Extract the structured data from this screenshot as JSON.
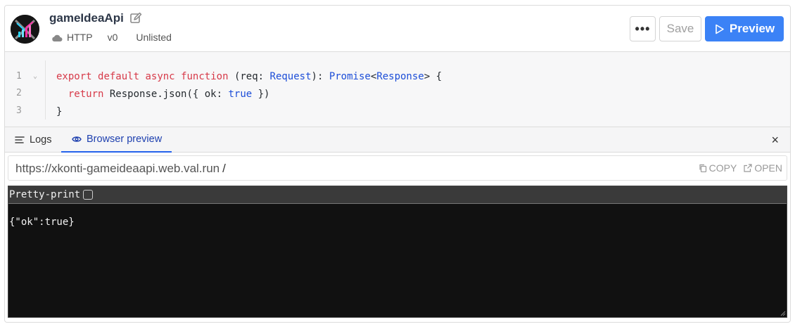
{
  "app": {
    "name": "gameIdeaApi",
    "meta": {
      "type": "HTTP",
      "version": "v0",
      "visibility": "Unlisted"
    }
  },
  "toolbar": {
    "more_label": "•••",
    "save_label": "Save",
    "preview_label": "Preview"
  },
  "editor": {
    "line_numbers": [
      "1",
      "2",
      "3"
    ],
    "code": {
      "l1_export": "export",
      "l1_default": "default",
      "l1_async": "async",
      "l1_function": "function",
      "l1_open": "(req: ",
      "l1_request": "Request",
      "l1_mid": "): ",
      "l1_promise": "Promise",
      "l1_lt": "<",
      "l1_response": "Response",
      "l1_gt": ">",
      "l1_brace": " {",
      "l2_indent": "  ",
      "l2_return": "return",
      "l2_response": "Response",
      "l2_json": ".json({ ok: ",
      "l2_true": "true",
      "l2_close": " })",
      "l3": "}"
    }
  },
  "tabs": [
    {
      "label": "Logs",
      "active": false
    },
    {
      "label": "Browser preview",
      "active": true
    }
  ],
  "close_label": "×",
  "preview": {
    "url": "https://xkonti-gameideaapi.web.val.run",
    "path": "/",
    "copy_label": "COPY",
    "open_label": "OPEN",
    "pretty_print_label": "Pretty-print",
    "pretty_print_checked": false,
    "response_body": "{\"ok\":true}"
  },
  "colors": {
    "accent": "#3b82f6",
    "keyword": "#d73a49",
    "type": "#1d4ed8",
    "terminal_bg": "#111111"
  },
  "icons": {
    "edit": "pencil-square-icon",
    "cloud": "cloud-icon",
    "preview": "play-icon",
    "logs": "list-icon",
    "browser": "eye-icon",
    "copy": "copy-icon",
    "open": "external-link-icon"
  }
}
